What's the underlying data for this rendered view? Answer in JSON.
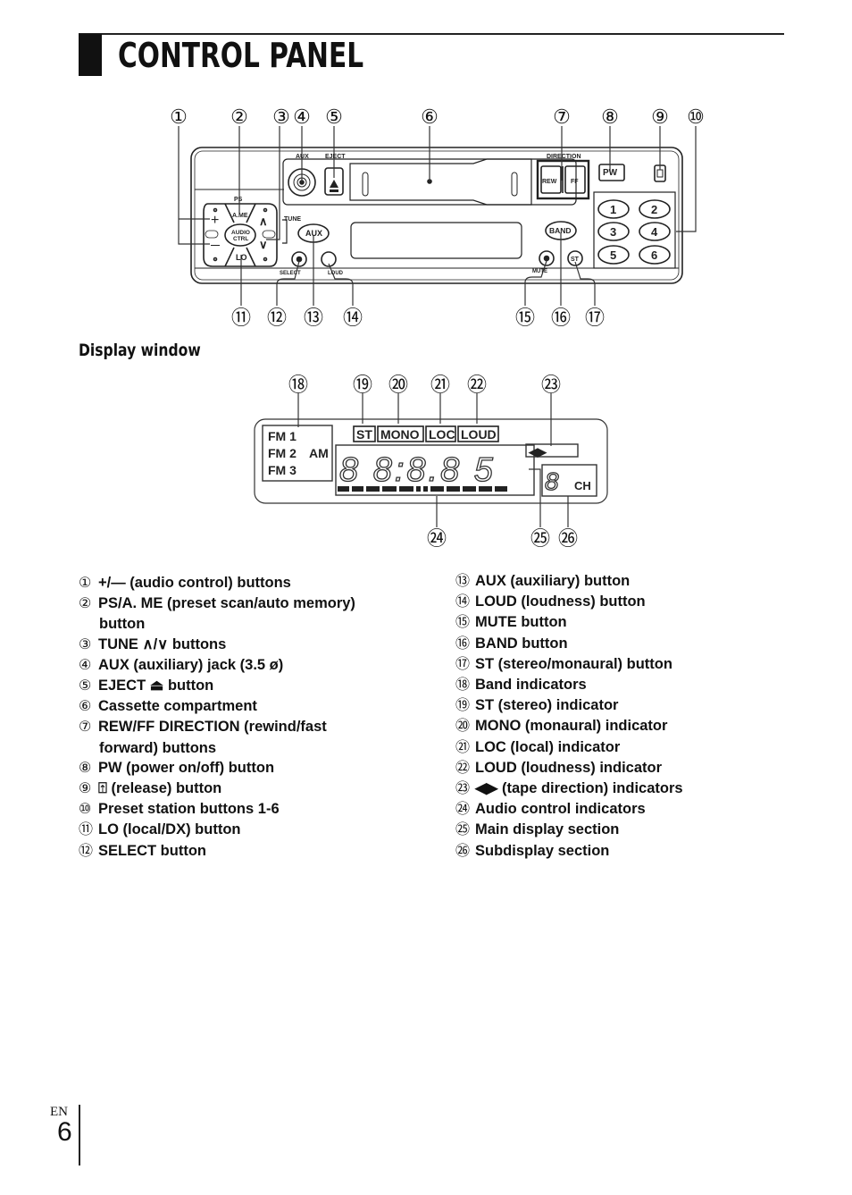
{
  "header": {
    "title": "CONTROL PANEL"
  },
  "panel": {
    "callouts": [
      "①",
      "②",
      "③",
      "④",
      "⑤",
      "⑥",
      "⑦",
      "⑧",
      "⑨",
      "⑩",
      "⑪",
      "⑫",
      "⑬",
      "⑭",
      "⑮",
      "⑯",
      "⑰"
    ],
    "labels": {
      "aux_jack": "AUX",
      "eject": "EJECT",
      "direction": "DIRECTION",
      "rew": "REW",
      "ff": "FF",
      "pw": "PW",
      "ps": "PS",
      "ame": "A.ME",
      "audio_ctrl_1": "AUDIO",
      "audio_ctrl_2": "CTRL",
      "tune": "TUNE",
      "lo": "LO",
      "aux_button": "AUX",
      "select": "SELECT",
      "loud": "LOUD",
      "band": "BAND",
      "mute": "MUTE",
      "st": "ST",
      "plus": "+",
      "minus": "—",
      "up": "∧",
      "down": "∨",
      "presets": [
        "1",
        "2",
        "3",
        "4",
        "5",
        "6"
      ]
    }
  },
  "display_section": {
    "heading": "Display window",
    "callouts": [
      "⑱",
      "⑲",
      "⑳",
      "㉑",
      "㉒",
      "㉓",
      "㉔",
      "㉕",
      "㉖"
    ],
    "bands": [
      "FM 1",
      "FM 2",
      "FM 3",
      "AM"
    ],
    "indicators": [
      "ST",
      "MONO",
      "LOC",
      "LOUD"
    ],
    "tape_direction": "◀▶",
    "main_digits": "8 8:8.8 5",
    "sub_digit": "8",
    "ch": "CH"
  },
  "legend": {
    "left": [
      {
        "num": "①",
        "text": "+/— (audio control) buttons"
      },
      {
        "num": "②",
        "text": "PS/A. ME (preset scan/auto memory)"
      },
      {
        "num": "",
        "text": "button"
      },
      {
        "num": "③",
        "text": "TUNE ∧/∨ buttons"
      },
      {
        "num": "④",
        "text": "AUX (auxiliary) jack (3.5 ø)"
      },
      {
        "num": "⑤",
        "text": "EJECT ⏏ button"
      },
      {
        "num": "⑥",
        "text": "Cassette compartment"
      },
      {
        "num": "⑦",
        "text": "REW/FF DIRECTION (rewind/fast"
      },
      {
        "num": "",
        "text": "forward) buttons"
      },
      {
        "num": "⑧",
        "text": "PW (power on/off) button"
      },
      {
        "num": "⑨",
        "text": "⍐ (release) button"
      },
      {
        "num": "⑩",
        "text": "Preset station buttons 1-6"
      },
      {
        "num": "⑪",
        "text": "LO (local/DX) button"
      },
      {
        "num": "⑫",
        "text": "SELECT button"
      }
    ],
    "right": [
      {
        "num": "⑬",
        "text": "AUX (auxiliary) button"
      },
      {
        "num": "⑭",
        "text": "LOUD (loudness) button"
      },
      {
        "num": "⑮",
        "text": "MUTE button"
      },
      {
        "num": "⑯",
        "text": "BAND button"
      },
      {
        "num": "⑰",
        "text": "ST (stereo/monaural) button"
      },
      {
        "num": "⑱",
        "text": "Band indicators"
      },
      {
        "num": "⑲",
        "text": "ST (stereo) indicator"
      },
      {
        "num": "⑳",
        "text": "MONO (monaural) indicator"
      },
      {
        "num": "㉑",
        "text": "LOC (local) indicator"
      },
      {
        "num": "㉒",
        "text": "LOUD (loudness) indicator"
      },
      {
        "num": "㉓",
        "text": "◀▶ (tape direction) indicators"
      },
      {
        "num": "㉔",
        "text": "Audio control indicators"
      },
      {
        "num": "㉕",
        "text": "Main display section"
      },
      {
        "num": "㉖",
        "text": "Subdisplay section"
      }
    ]
  },
  "footer": {
    "lang": "EN",
    "page": "6"
  }
}
